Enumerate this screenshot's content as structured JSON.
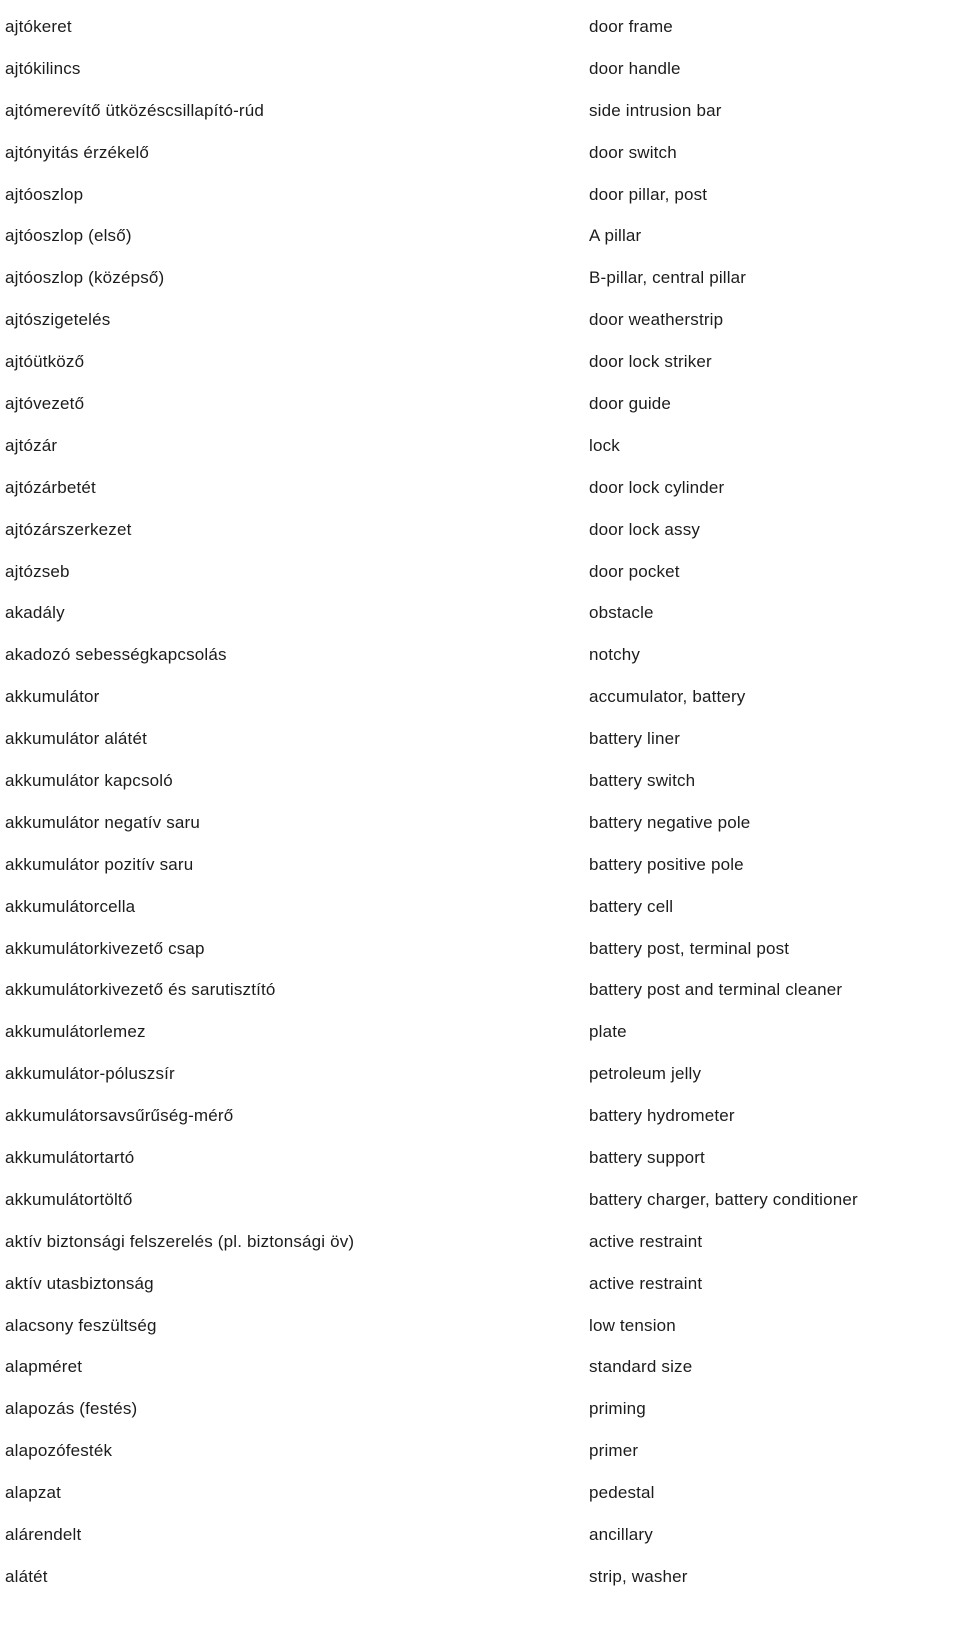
{
  "document": {
    "type": "bilingual-glossary",
    "source_language_label": "Hungarian",
    "target_language_label": "English",
    "text_color": "#1c1c1c",
    "background_color": "#ffffff",
    "entry_count": 38
  },
  "entries": [
    {
      "source": "ajtókeret",
      "target": "door frame"
    },
    {
      "source": "ajtókilincs",
      "target": "door handle"
    },
    {
      "source": "ajtómerevítő ütközéscsillapító-rúd",
      "target": "side intrusion bar"
    },
    {
      "source": "ajtónyitás érzékelő",
      "target": "door switch"
    },
    {
      "source": "ajtóoszlop",
      "target": "door pillar, post"
    },
    {
      "source": "ajtóoszlop (első)",
      "target": "A pillar"
    },
    {
      "source": "ajtóoszlop (középső)",
      "target": "B-pillar, central pillar"
    },
    {
      "source": "ajtószigetelés",
      "target": "door weatherstrip"
    },
    {
      "source": "ajtóütköző",
      "target": "door lock striker"
    },
    {
      "source": "ajtóvezető",
      "target": "door guide"
    },
    {
      "source": "ajtózár",
      "target": "lock"
    },
    {
      "source": "ajtózárbetét",
      "target": "door lock cylinder"
    },
    {
      "source": "ajtózárszerkezet",
      "target": "door lock assy"
    },
    {
      "source": "ajtózseb",
      "target": "door pocket"
    },
    {
      "source": "akadály",
      "target": "obstacle"
    },
    {
      "source": "akadozó sebességkapcsolás",
      "target": "notchy"
    },
    {
      "source": "akkumulátor",
      "target": "accumulator, battery"
    },
    {
      "source": "akkumulátor alátét",
      "target": "battery liner"
    },
    {
      "source": "akkumulátor kapcsoló",
      "target": "battery switch"
    },
    {
      "source": "akkumulátor negatív saru",
      "target": "battery negative pole"
    },
    {
      "source": "akkumulátor pozitív saru",
      "target": "battery positive pole"
    },
    {
      "source": "akkumulátorcella",
      "target": "battery cell"
    },
    {
      "source": "akkumulátorkivezető csap",
      "target": "battery post, terminal post"
    },
    {
      "source": "akkumulátorkivezető és sarutisztító",
      "target": "battery post and terminal cleaner"
    },
    {
      "source": "akkumulátorlemez",
      "target": "plate"
    },
    {
      "source": "akkumulátor-póluszsír",
      "target": "petroleum jelly"
    },
    {
      "source": "akkumulátorsavsűrűség-mérő",
      "target": "battery hydrometer"
    },
    {
      "source": "akkumulátortartó",
      "target": "battery support"
    },
    {
      "source": "akkumulátortöltő",
      "target": "battery charger, battery conditioner"
    },
    {
      "source": "aktív biztonsági felszerelés (pl. biztonsági öv)",
      "target": "active restraint"
    },
    {
      "source": "aktív utasbiztonság",
      "target": "active restraint"
    },
    {
      "source": "alacsony feszültség",
      "target": "low tension"
    },
    {
      "source": "alapméret",
      "target": "standard size"
    },
    {
      "source": "alapozás (festés)",
      "target": "priming"
    },
    {
      "source": "alapozófesték",
      "target": "primer"
    },
    {
      "source": "alapzat",
      "target": "pedestal"
    },
    {
      "source": "alárendelt",
      "target": "ancillary"
    },
    {
      "source": "alátét",
      "target": "strip, washer"
    }
  ]
}
